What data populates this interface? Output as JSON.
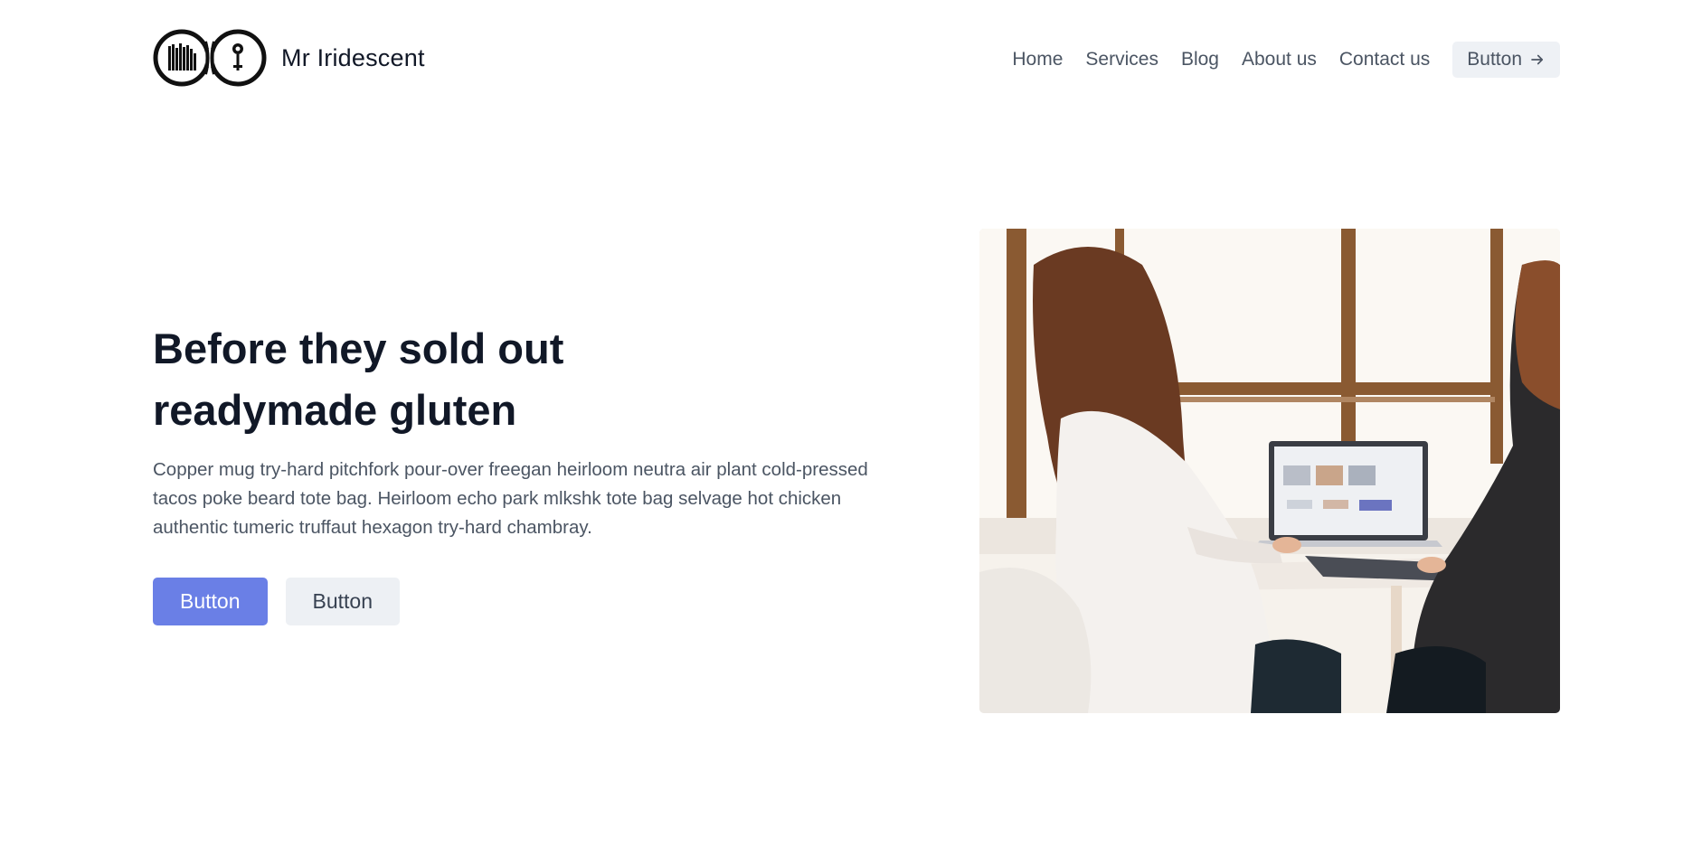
{
  "header": {
    "brand": "Mr Iridescent",
    "logo_icon": "mr-logo-icon",
    "nav": [
      {
        "label": "Home"
      },
      {
        "label": "Services"
      },
      {
        "label": "Blog"
      },
      {
        "label": "About us"
      },
      {
        "label": "Contact us"
      }
    ],
    "cta_label": "Button",
    "cta_icon": "arrow-right-icon"
  },
  "hero": {
    "title_line1": "Before they sold out",
    "title_line2": "readymade gluten",
    "description": "Copper mug try-hard pitchfork pour-over freegan heirloom neutra air plant cold-pressed tacos poke beard tote bag. Heirloom echo park mlkshk tote bag selvage hot chicken authentic tumeric truffaut hexagon try-hard chambray.",
    "primary_button": "Button",
    "secondary_button": "Button",
    "image_subject": "two women at a table with a laptop near a window"
  },
  "colors": {
    "primary": "#6a7fe6",
    "secondary_bg": "#edf0f4",
    "heading": "#111827",
    "body_text": "#4b5563"
  }
}
